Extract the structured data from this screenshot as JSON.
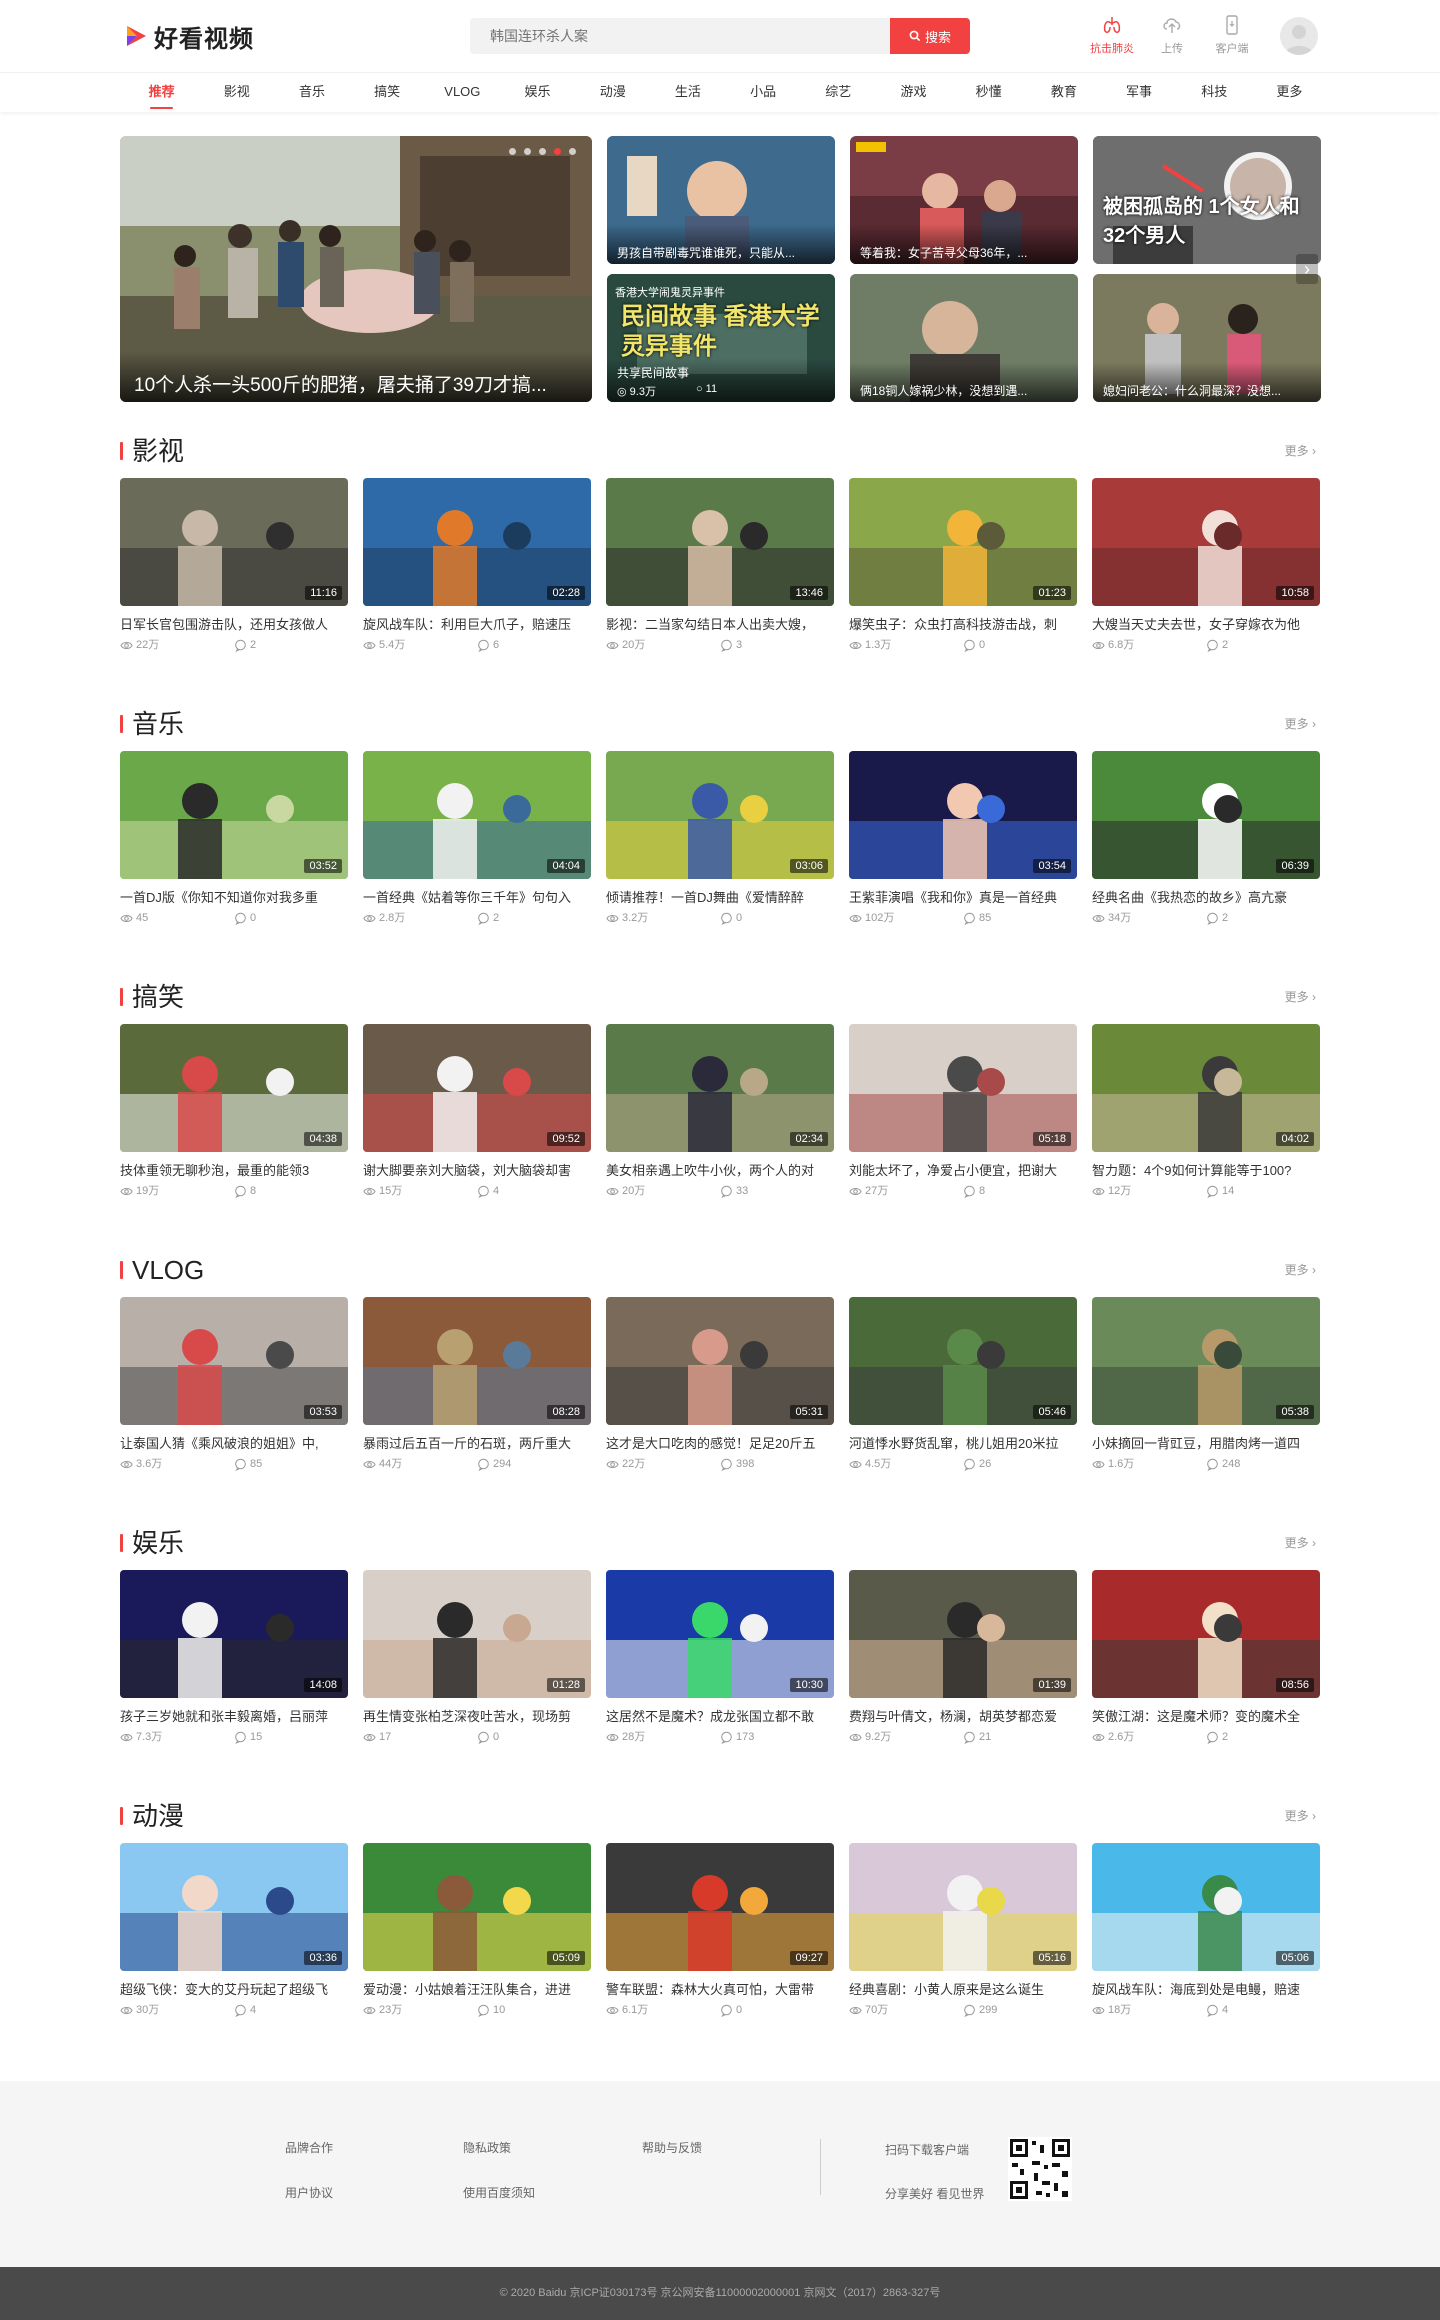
{
  "header": {
    "logo_text": "好看视频",
    "search_placeholder": "韩国连环杀人案",
    "search_button": "搜索",
    "actions": [
      {
        "label": "抗击肺炎",
        "icon": "lungs-icon"
      },
      {
        "label": "上传",
        "icon": "upload-icon"
      },
      {
        "label": "客户端",
        "icon": "phone-icon"
      }
    ]
  },
  "nav": [
    "推荐",
    "影视",
    "音乐",
    "搞笑",
    "VLOG",
    "娱乐",
    "动漫",
    "生活",
    "小品",
    "综艺",
    "游戏",
    "秒懂",
    "教育",
    "军事",
    "科技",
    "更多"
  ],
  "banner": {
    "main_caption": "10个人杀一头500斤的肥猪，屠夫捅了39刀才搞...",
    "small": [
      {
        "caption": "男孩自带剧毒咒谁谁死，只能从..."
      },
      {
        "caption": "等着我：女子苦寻父母36年，..."
      },
      {
        "caption": "",
        "overlay": "被困孤岛的 1个女人和32个男人"
      },
      {
        "caption": "共享民间故事",
        "overlay": "民间故事 香港大学 灵异事件",
        "top_text": "香港大学闹鬼灵异事件",
        "views": "9.3万",
        "comments": "11"
      },
      {
        "caption": "俩18铜人嫁祸少林，没想到遇..."
      },
      {
        "caption": "媳妇问老公：什么洞最深？没想..."
      }
    ]
  },
  "sections": [
    {
      "title": "影视",
      "more": "更多",
      "cards": [
        {
          "title": "日军长官包围游击队，还用女孩做人",
          "duration": "11:16",
          "views": "22万",
          "comments": "2"
        },
        {
          "title": "旋风战车队：利用巨大爪子，赔速压",
          "duration": "02:28",
          "views": "5.4万",
          "comments": "6"
        },
        {
          "title": "影视：二当家勾结日本人出卖大嫂，",
          "duration": "13:46",
          "views": "20万",
          "comments": "3"
        },
        {
          "title": "爆笑虫子：众虫打高科技游击战，刺",
          "duration": "01:23",
          "views": "1.3万",
          "comments": "0"
        },
        {
          "title": "大嫂当天丈夫去世，女子穿嫁衣为他",
          "duration": "10:58",
          "views": "6.8万",
          "comments": "2"
        }
      ]
    },
    {
      "title": "音乐",
      "more": "更多",
      "cards": [
        {
          "title": "一首DJ版《你知不知道你对我多重",
          "duration": "03:52",
          "views": "45",
          "comments": "0"
        },
        {
          "title": "一首经典《姑着等你三千年》句句入",
          "duration": "04:04",
          "views": "2.8万",
          "comments": "2"
        },
        {
          "title": "倾请推荐！一首DJ舞曲《爱情醉醉",
          "duration": "03:06",
          "views": "3.2万",
          "comments": "0"
        },
        {
          "title": "王紫菲演唱《我和你》真是一首经典",
          "duration": "03:54",
          "views": "102万",
          "comments": "85"
        },
        {
          "title": "经典名曲《我热恋的故乡》高亢豪",
          "duration": "06:39",
          "views": "34万",
          "comments": "2"
        }
      ]
    },
    {
      "title": "搞笑",
      "more": "更多",
      "cards": [
        {
          "title": "技体重领无聊秒泡，最重的能领3",
          "duration": "04:38",
          "views": "19万",
          "comments": "8"
        },
        {
          "title": "谢大脚要亲刘大脑袋，刘大脑袋却害",
          "duration": "09:52",
          "views": "15万",
          "comments": "4"
        },
        {
          "title": "美女相亲遇上吹牛小伙，两个人的对",
          "duration": "02:34",
          "views": "20万",
          "comments": "33"
        },
        {
          "title": "刘能太坏了，净爱占小便宜，把谢大",
          "duration": "05:18",
          "views": "27万",
          "comments": "8"
        },
        {
          "title": "智力题：4个9如何计算能等于100?",
          "duration": "04:02",
          "views": "12万",
          "comments": "14"
        }
      ]
    },
    {
      "title": "VLOG",
      "more": "更多",
      "cards": [
        {
          "title": "让泰国人猜《乘风破浪的姐姐》中,",
          "duration": "03:53",
          "views": "3.6万",
          "comments": "85"
        },
        {
          "title": "暴雨过后五百一斤的石斑，两斤重大",
          "duration": "08:28",
          "views": "44万",
          "comments": "294"
        },
        {
          "title": "这才是大口吃肉的感觉！足足20斤五",
          "duration": "05:31",
          "views": "22万",
          "comments": "398"
        },
        {
          "title": "河道悸水野货乱窜，桃儿姐用20米拉",
          "duration": "05:46",
          "views": "4.5万",
          "comments": "26"
        },
        {
          "title": "小妹摘回一背豇豆，用腊肉烤一道四",
          "duration": "05:38",
          "views": "1.6万",
          "comments": "248"
        }
      ]
    },
    {
      "title": "娱乐",
      "more": "更多",
      "cards": [
        {
          "title": "孩子三岁她就和张丰毅离婚，吕丽萍",
          "duration": "14:08",
          "views": "7.3万",
          "comments": "15"
        },
        {
          "title": "再生情变张柏芝深夜吐苦水，现场剪",
          "duration": "01:28",
          "views": "17",
          "comments": "0"
        },
        {
          "title": "这居然不是魔术？成龙张国立都不敢",
          "duration": "10:30",
          "views": "28万",
          "comments": "173"
        },
        {
          "title": "费翔与叶倩文，杨澜，胡英梦都恋爱",
          "duration": "01:39",
          "views": "9.2万",
          "comments": "21"
        },
        {
          "title": "笑傲江湖：这是魔术师？变的魔术全",
          "duration": "08:56",
          "views": "2.6万",
          "comments": "2"
        }
      ]
    },
    {
      "title": "动漫",
      "more": "更多",
      "cards": [
        {
          "title": "超级飞侠：变大的艾丹玩起了超级飞",
          "duration": "03:36",
          "views": "30万",
          "comments": "4"
        },
        {
          "title": "爱动漫：小姑娘着汪汪队集合，进进",
          "duration": "05:09",
          "views": "23万",
          "comments": "10"
        },
        {
          "title": "警车联盟：森林大火真可怕，大雷带",
          "duration": "09:27",
          "views": "6.1万",
          "comments": "0"
        },
        {
          "title": "经典喜剧：小黄人原来是这么诞生",
          "duration": "05:16",
          "views": "70万",
          "comments": "299"
        },
        {
          "title": "旋风战车队：海底到处是电鳗，赔速",
          "duration": "05:06",
          "views": "18万",
          "comments": "4"
        }
      ]
    }
  ],
  "footer": {
    "links": [
      "品牌合作",
      "隐私政策",
      "帮助与反馈",
      "用户协议",
      "使用百度须知"
    ],
    "download_title": "扫码下载客户端",
    "download_slogan": "分享美好 看见世界",
    "copyright": "© 2020 Baidu 京ICP证030173号  京公网安备11000002000001  京网文（2017）2863-327号"
  },
  "colors": {
    "accent": "#f24141",
    "footer_bg": "#f5f5f5",
    "copyright_bg": "#4a4a4a"
  }
}
